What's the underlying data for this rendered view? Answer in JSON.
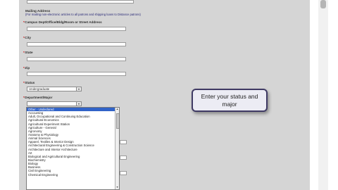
{
  "mailing": {
    "heading": "Mailing Address",
    "note": "(For mailing non-electronic articles to all patrons and shipping loans to Distance patrons)"
  },
  "fields": {
    "campus_label": "Campus Dept/Office/Bldg/Room or Street Address",
    "city_label": "City",
    "state_label": "State",
    "zip_label": "Zip",
    "status_label": "Status",
    "status_value": "Undergraduate",
    "department_label": "Department/Major",
    "department_value": "",
    "required_mark": "*"
  },
  "department_options": [
    "Other - Undeclared",
    "Accounting",
    "Adult, Occupational and Continuing Education",
    "Agricultural Economics",
    "Agricultural Experiment Station",
    "Agriculture - General",
    "Agronomy",
    "Anatomy & Physiology",
    "Animal Sciences",
    "Apparel, Textiles & Interior Design",
    "Architectural Engineering & Construction Science",
    "Architecture and Interior Architecture",
    "Art",
    "Biological and Agricultural Engineering",
    "Biochemistry",
    "Biology",
    "Business",
    "Civil Engineering",
    "Chemical Engineering"
  ],
  "tooltip": {
    "text": "Enter your status and major"
  },
  "icons": {
    "dropdown_arrow": "chevron-down-icon"
  }
}
